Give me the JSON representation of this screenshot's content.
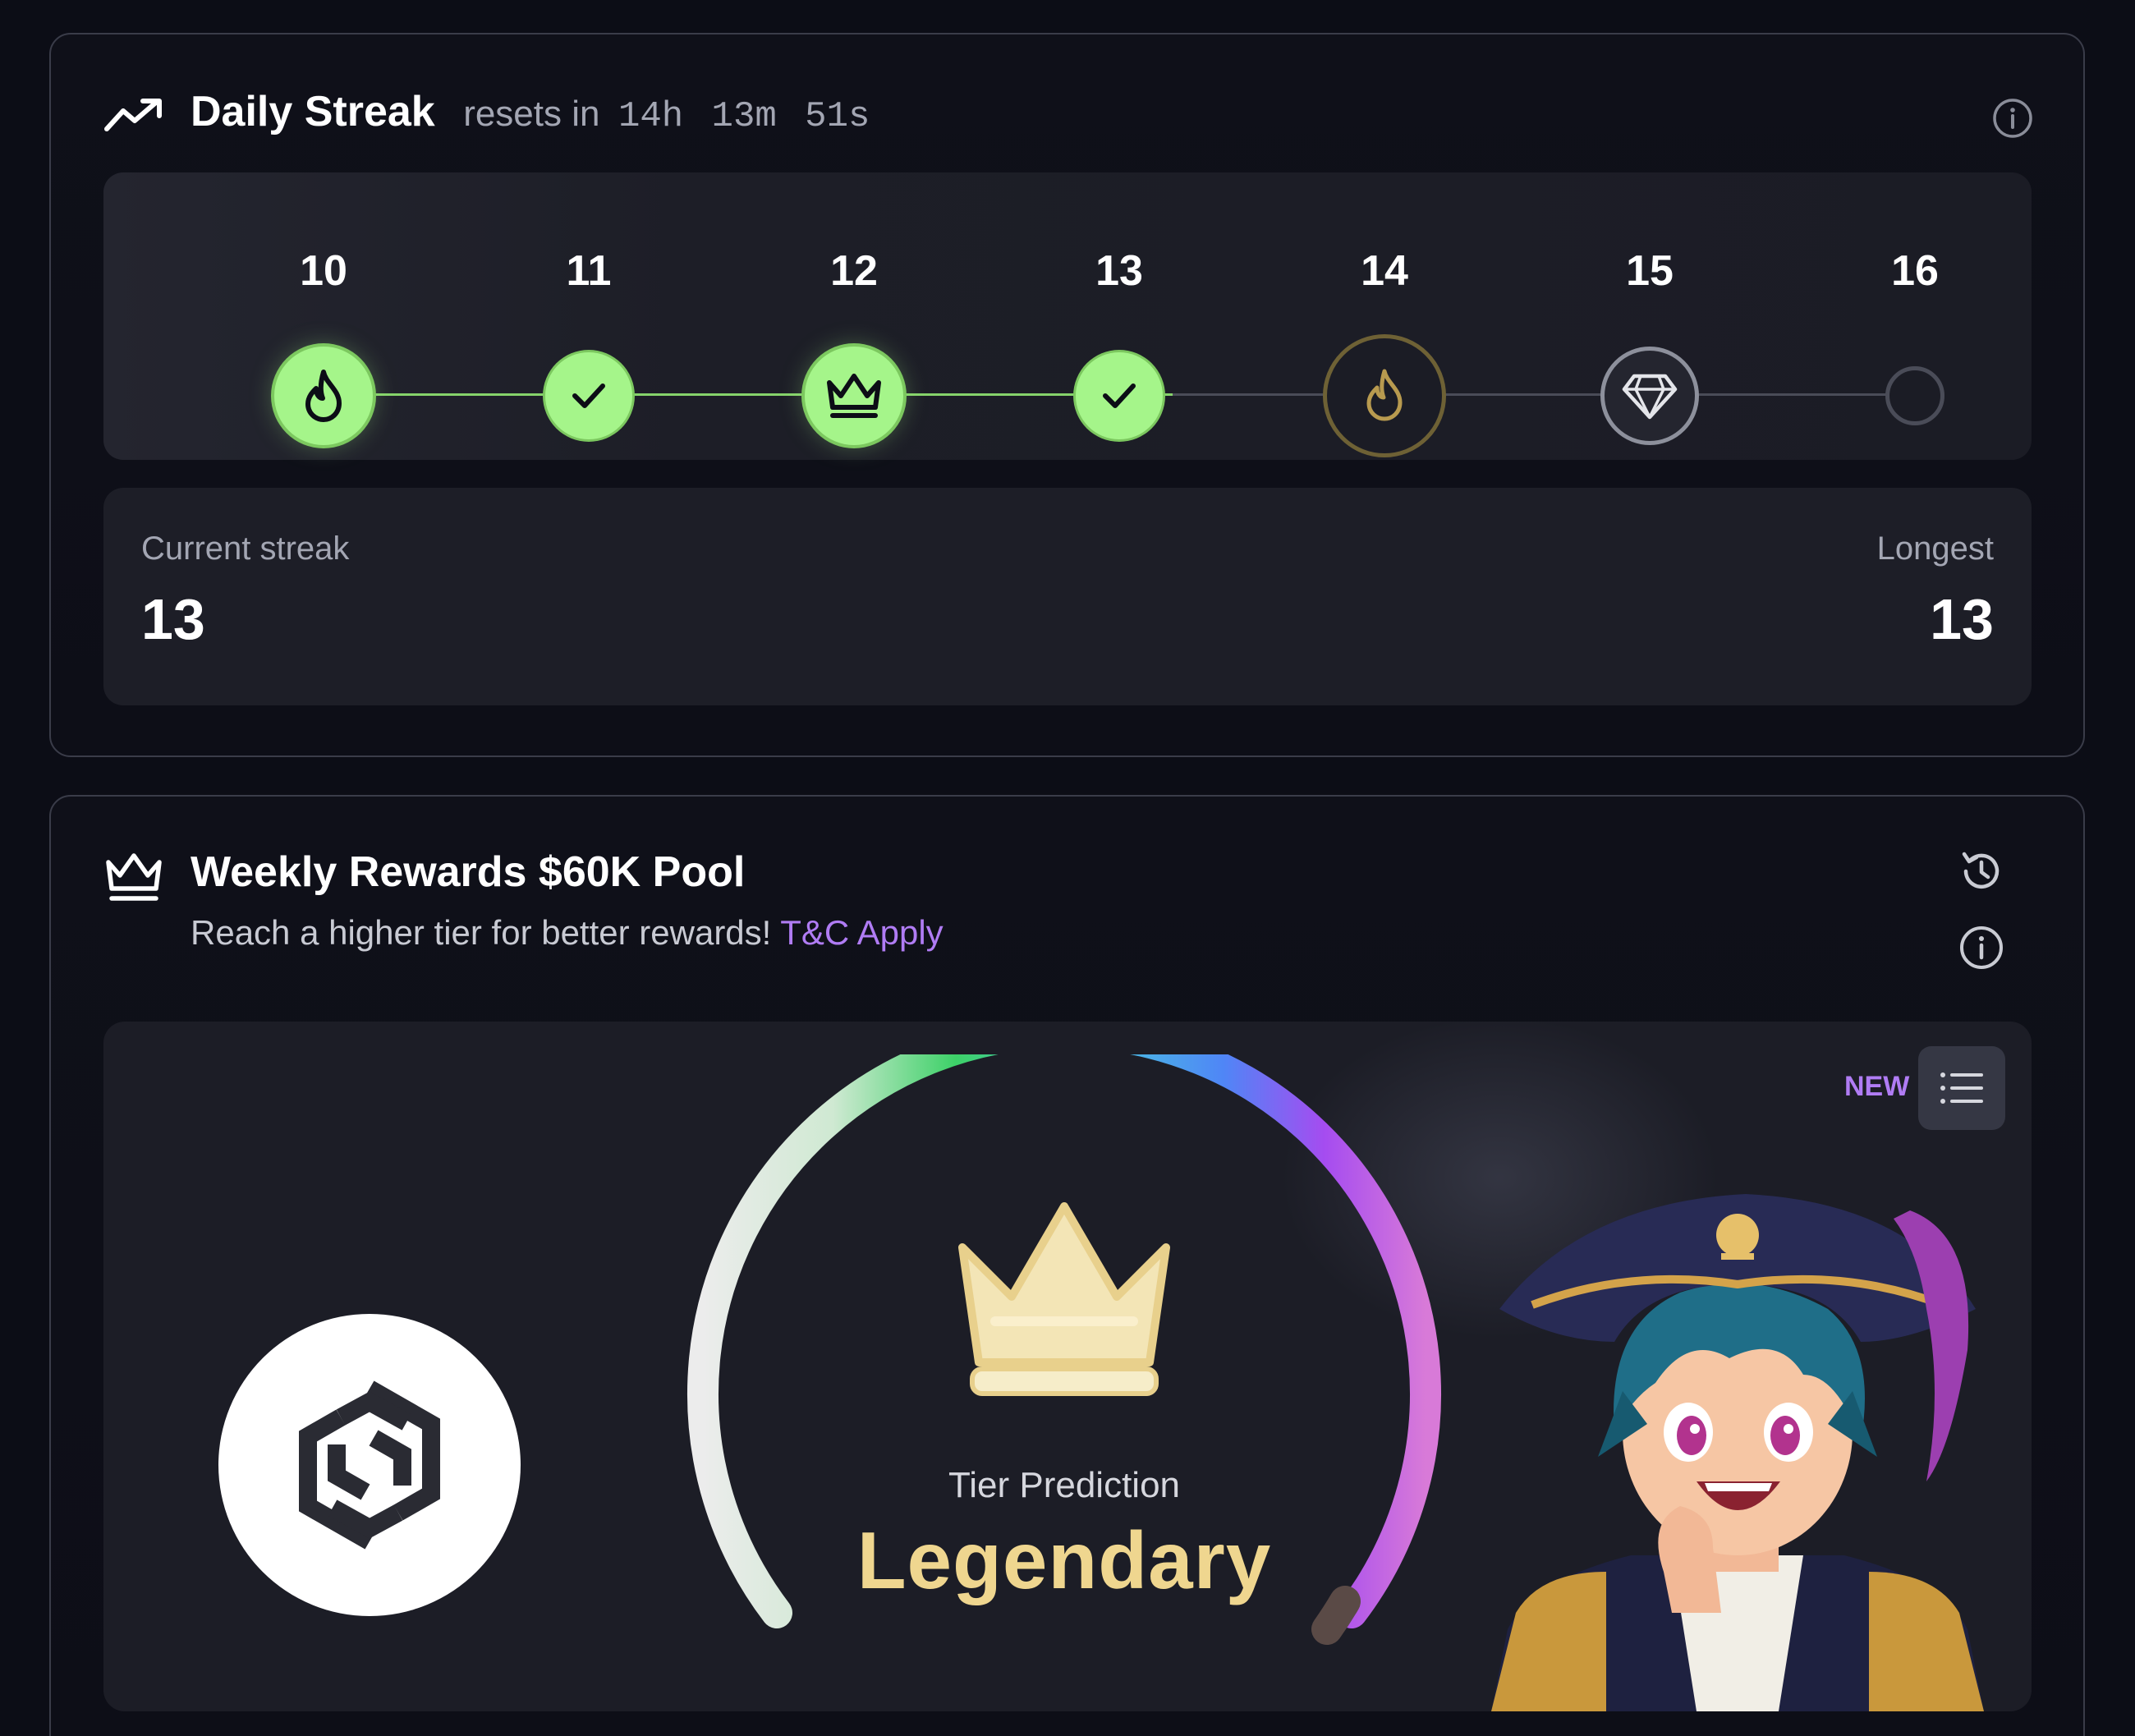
{
  "streak": {
    "title": "Daily Streak",
    "resets_prefix": "resets in",
    "countdown": "14h 13m 51s",
    "days": [
      {
        "label": "10",
        "state": "completed",
        "icon": "flame-icon"
      },
      {
        "label": "11",
        "state": "completed",
        "icon": "check-icon"
      },
      {
        "label": "12",
        "state": "completed",
        "icon": "crown-icon"
      },
      {
        "label": "13",
        "state": "completed",
        "icon": "check-icon"
      },
      {
        "label": "14",
        "state": "upcoming-milestone",
        "icon": "flame-icon"
      },
      {
        "label": "15",
        "state": "upcoming-milestone",
        "icon": "diamond-icon"
      },
      {
        "label": "16",
        "state": "upcoming",
        "icon": "empty-circle-icon"
      }
    ],
    "current_label": "Current streak",
    "current_value": "13",
    "longest_label": "Longest",
    "longest_value": "13"
  },
  "rewards": {
    "title": "Weekly Rewards $60K Pool",
    "subtitle": "Reach a higher tier for better rewards!",
    "tc_link": "T&C Apply",
    "new_badge": "NEW",
    "tier_label": "Tier Prediction",
    "tier_value": "Legendary"
  },
  "colors": {
    "accent_green": "#a5f58a",
    "gold": "#efd68f",
    "purple_link": "#b07cf4",
    "card_bg": "#0f1019",
    "panel_bg": "#1d1e27"
  }
}
